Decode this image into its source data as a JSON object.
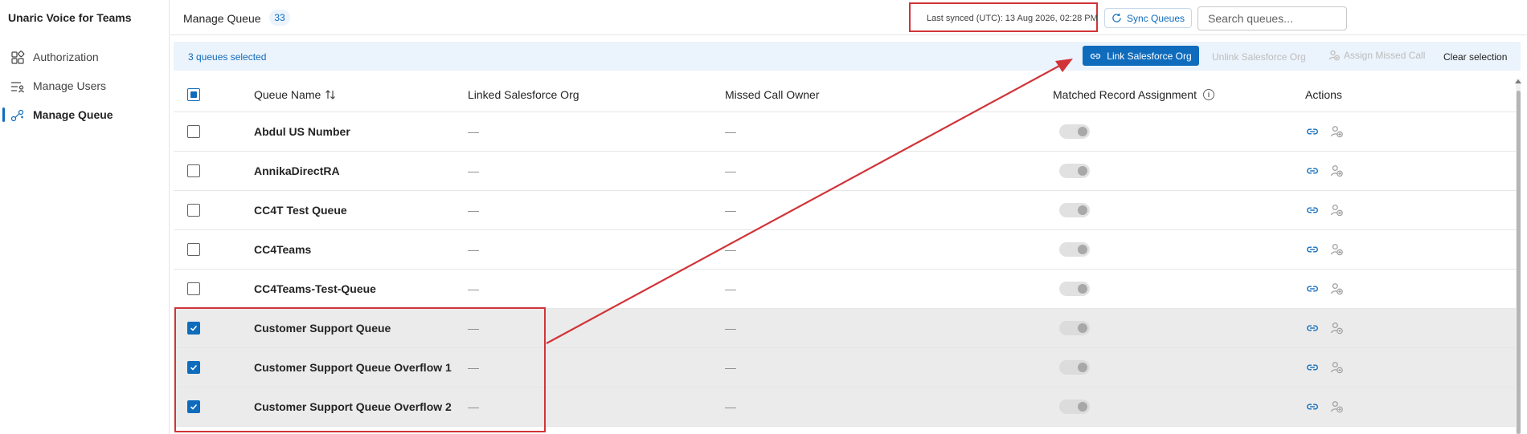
{
  "app": {
    "title": "Unaric Voice for Teams"
  },
  "sidebar": {
    "items": [
      {
        "label": "Authorization",
        "icon": "apps-icon",
        "active": false
      },
      {
        "label": "Manage Users",
        "icon": "people-list-icon",
        "active": false
      },
      {
        "label": "Manage Queue",
        "icon": "queue-flow-icon",
        "active": true
      }
    ]
  },
  "header": {
    "title": "Manage Queue",
    "count": "33",
    "last_synced": "Last synced (UTC): 13 Aug 2026, 02:28 PM",
    "sync_label": "Sync Queues",
    "search_placeholder": "Search queues..."
  },
  "selection_bar": {
    "count_label": "3 queues selected",
    "link_label": "Link Salesforce Org",
    "unlink_label": "Unlink Salesforce Org",
    "assign_label": "Assign Missed Call",
    "clear_label": "Clear selection"
  },
  "table": {
    "columns": {
      "name": "Queue Name",
      "org": "Linked Salesforce Org",
      "owner": "Missed Call Owner",
      "matched": "Matched Record Assignment",
      "actions": "Actions"
    },
    "rows": [
      {
        "name": "Abdul US Number",
        "org": "—",
        "owner": "—",
        "selected": false
      },
      {
        "name": "AnnikaDirectRA",
        "org": "—",
        "owner": "—",
        "selected": false
      },
      {
        "name": "CC4T Test Queue",
        "org": "—",
        "owner": "—",
        "selected": false
      },
      {
        "name": "CC4Teams",
        "org": "—",
        "owner": "—",
        "selected": false
      },
      {
        "name": "CC4Teams-Test-Queue",
        "org": "—",
        "owner": "—",
        "selected": false
      },
      {
        "name": "Customer Support Queue",
        "org": "—",
        "owner": "—",
        "selected": true
      },
      {
        "name": "Customer Support Queue Overflow 1",
        "org": "—",
        "owner": "—",
        "selected": true
      },
      {
        "name": "Customer Support Queue Overflow 2",
        "org": "—",
        "owner": "—",
        "selected": true
      }
    ]
  },
  "colors": {
    "accent": "#0f6cbd",
    "annotation": "#d13438",
    "selected_row": "#ebebeb",
    "selection_bar": "#ebf3fc"
  }
}
